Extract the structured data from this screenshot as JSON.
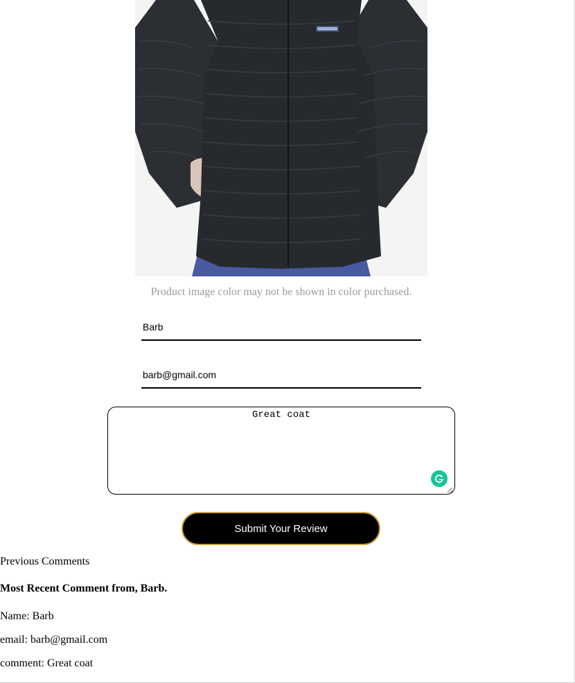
{
  "product": {
    "image_alt": "black hooded down puffer jacket",
    "brand_tag": "patagonia",
    "caption": "Product image color may not be shown in color purchased."
  },
  "form": {
    "name_value": "Barb",
    "email_value": "barb@gmail.com",
    "comment_value": "Great coat",
    "submit_label": "Submit Your Review"
  },
  "comments": {
    "heading": "Previous Comments",
    "recent_heading": "Most Recent Comment from, Barb.",
    "name_line": "Name: Barb",
    "email_line": "email: barb@gmail.com",
    "comment_line": "comment: Great coat"
  },
  "colors": {
    "submit_background": "#000000",
    "submit_border": "#c8a13a",
    "grammar_badge": "#15c39a",
    "caption_text": "#9a9a9a"
  },
  "icons": {
    "grammar_badge": "grammarly-icon",
    "resize": "resize-handle-icon"
  }
}
